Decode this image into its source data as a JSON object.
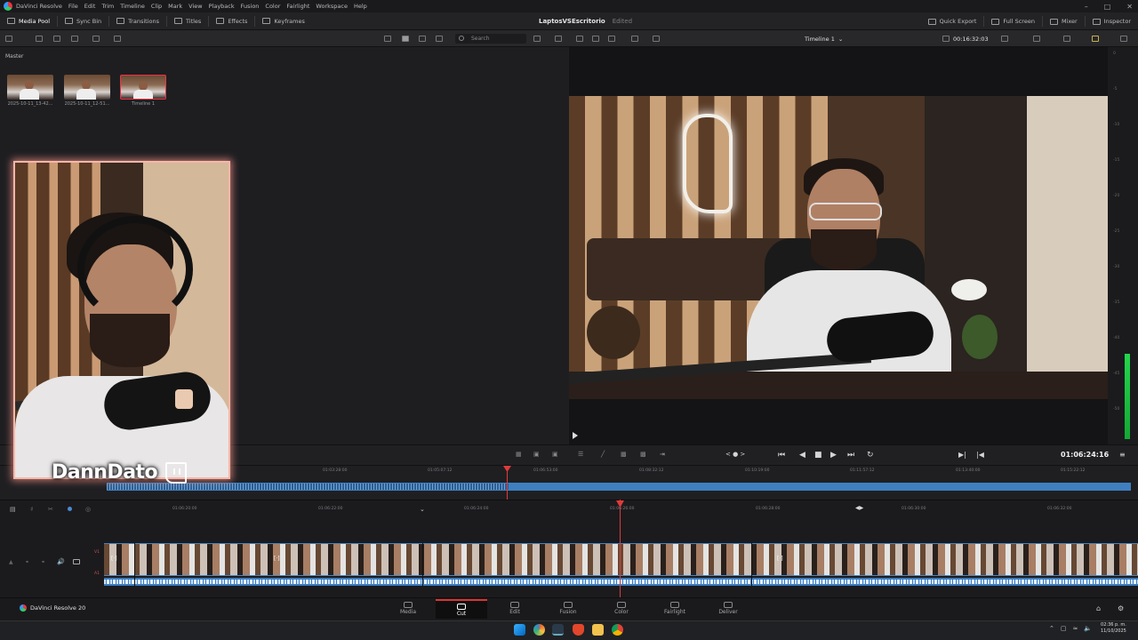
{
  "app": {
    "name": "DaVinci Resolve",
    "menu": [
      "File",
      "Edit",
      "Trim",
      "Timeline",
      "Clip",
      "Mark",
      "View",
      "Playback",
      "Fusion",
      "Color",
      "Fairlight",
      "Workspace",
      "Help"
    ]
  },
  "toolbar": {
    "left": [
      "Media Pool",
      "Sync Bin",
      "Transitions",
      "Titles",
      "Effects",
      "Keyframes"
    ],
    "project_name": "LaptosVSEscritorio",
    "project_status": "Edited",
    "right": [
      "Quick Export",
      "Full Screen",
      "Mixer",
      "Inspector"
    ]
  },
  "search": {
    "placeholder": "Search"
  },
  "timeline_select": "Timeline 1",
  "timecode_top": "00:16:32:03",
  "media_pool": {
    "bin": "Master",
    "clips": [
      {
        "label": "2025-10-11_13-42..."
      },
      {
        "label": "2025-10-11_12-51..."
      },
      {
        "label": "Timeline 1"
      }
    ]
  },
  "overlay": {
    "streamer_name": "DannDato"
  },
  "meter": {
    "ticks": [
      "0",
      "-5",
      "-10",
      "-15",
      "-20",
      "-25",
      "-30",
      "-35",
      "-40",
      "-45",
      "-50"
    ],
    "level_fraction": 0.22
  },
  "transport": {
    "timecode": "01:06:24:16"
  },
  "strip_ruler": [
    "01:03:28:00",
    "01:05:07:12",
    "01:06:53:00",
    "01:08:32:12",
    "01:10:19:00",
    "01:11:57:12",
    "01:13:40:00",
    "01:15:22:12"
  ],
  "timeline_ruler": [
    "01:06:20:00",
    "01:06:22:00",
    "01:06:24:00",
    "01:06:26:00",
    "01:06:28:00",
    "01:06:30:00",
    "01:06:32:00"
  ],
  "tracks": {
    "video": "V1",
    "audio": "A1"
  },
  "pages": [
    {
      "label": "Media",
      "active": false
    },
    {
      "label": "Cut",
      "active": true
    },
    {
      "label": "Edit",
      "active": false
    },
    {
      "label": "Fusion",
      "active": false
    },
    {
      "label": "Color",
      "active": false
    },
    {
      "label": "Fairlight",
      "active": false
    },
    {
      "label": "Deliver",
      "active": false
    }
  ],
  "brand": "DaVinci Resolve 20",
  "taskbar": {
    "time": "02:36 p. m.",
    "date": "11/10/2025"
  }
}
